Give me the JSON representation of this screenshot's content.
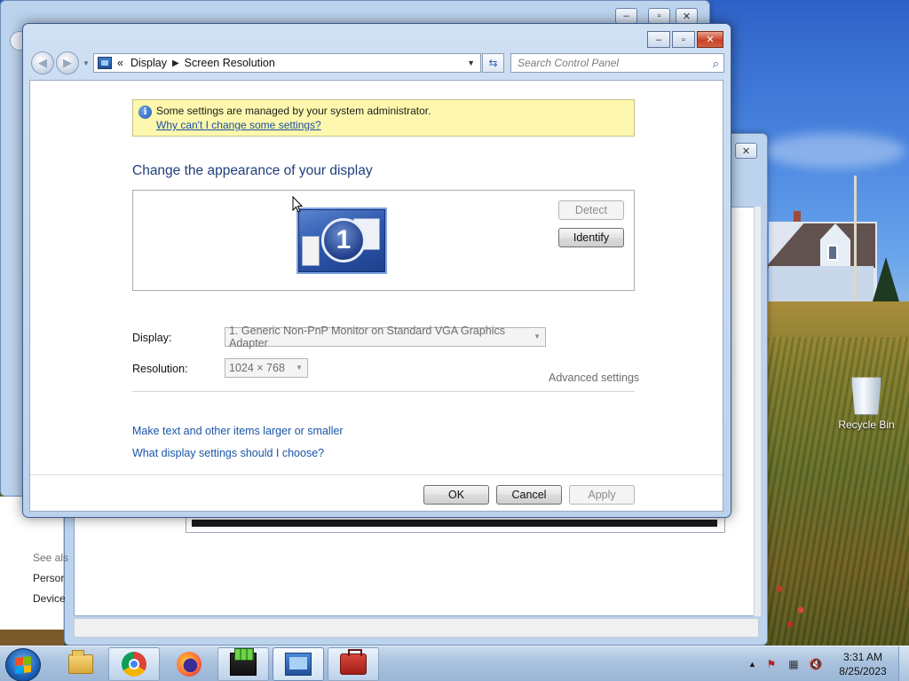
{
  "window": {
    "address": {
      "chevrons": "«",
      "crumbs": [
        "Display",
        "Screen Resolution"
      ]
    },
    "search_placeholder": "Search Control Panel",
    "info_bar": {
      "message": "Some settings are managed by your system administrator.",
      "link": "Why can't I change some settings?"
    },
    "heading": "Change the appearance of your display",
    "monitor_number": "1",
    "detect_label": "Detect",
    "identify_label": "Identify",
    "display_label": "Display:",
    "display_value": "1. Generic Non-PnP Monitor on Standard VGA Graphics Adapter",
    "resolution_label": "Resolution:",
    "resolution_value": "1024 × 768",
    "advanced_settings": "Advanced settings",
    "link_text_size": "Make text and other items larger or smaller",
    "link_help": "What display settings should I choose?",
    "ok_label": "OK",
    "cancel_label": "Cancel",
    "apply_label": "Apply"
  },
  "background_window": {
    "see_also": "See als",
    "items": [
      "Persor",
      "Device"
    ]
  },
  "desktop": {
    "recycle_bin": "Recycle Bin"
  },
  "taskbar": {
    "apps": [
      "windows-explorer-icon",
      "chrome-icon",
      "firefox-icon",
      "minecraft-icon",
      "control-panel-icon",
      "toolbox-icon"
    ],
    "time": "3:31 AM",
    "date": "8/25/2023"
  },
  "colors": {
    "link": "#1a55a8",
    "heading": "#1f3f7c",
    "info_bg": "#fdf8ad"
  }
}
